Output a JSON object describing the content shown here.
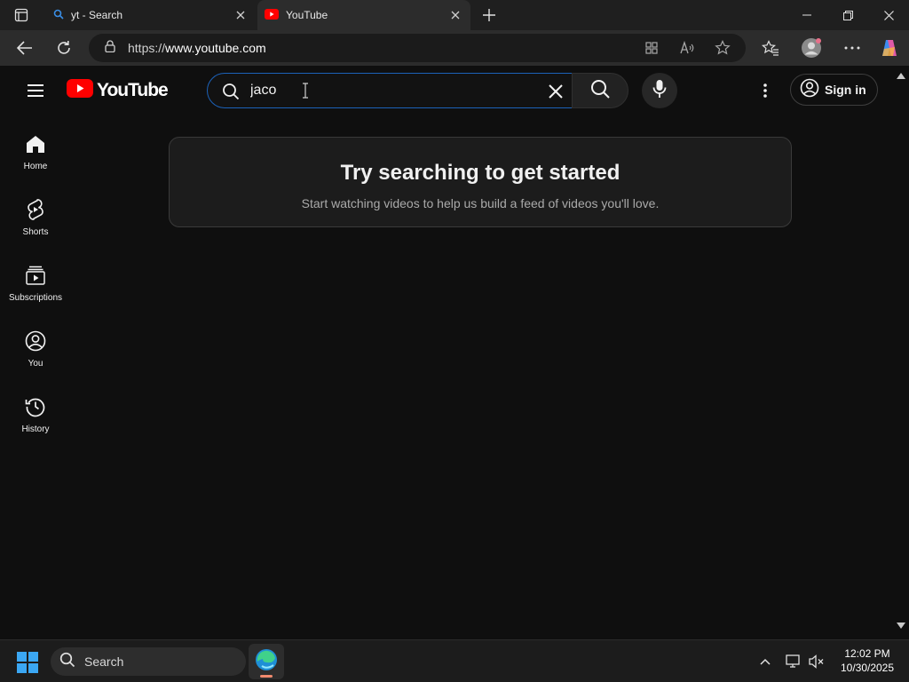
{
  "browser": {
    "tabs": [
      {
        "title": "yt - Search",
        "active": false,
        "favicon": "search-favicon"
      },
      {
        "title": "YouTube",
        "active": true,
        "favicon": "youtube-favicon"
      }
    ],
    "url_prefix": "https://",
    "url_host": "www.youtube.com"
  },
  "youtube": {
    "logo_text": "YouTube",
    "search_query": "jaco",
    "signin_label": "Sign in",
    "brand_color": "#ff0000",
    "rail": [
      {
        "label": "Home",
        "icon": "home-icon"
      },
      {
        "label": "Shorts",
        "icon": "shorts-icon"
      },
      {
        "label": "Subscriptions",
        "icon": "subscriptions-icon"
      },
      {
        "label": "You",
        "icon": "you-icon"
      },
      {
        "label": "History",
        "icon": "history-icon"
      }
    ],
    "empty_state": {
      "heading": "Try searching to get started",
      "body": "Start watching videos to help us build a feed of videos you'll love."
    }
  },
  "taskbar": {
    "search_label": "Search",
    "time": "12:02 PM",
    "date": "10/30/2025"
  }
}
